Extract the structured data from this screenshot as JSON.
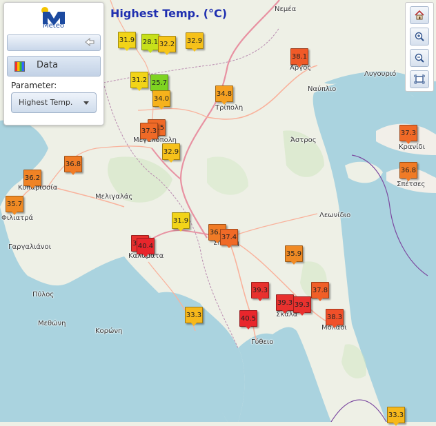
{
  "title": "Highest Temp. (°C)",
  "logo_text": "Meteo",
  "panel": {
    "data_tab_label": "Data",
    "parameter_label": "Parameter:",
    "parameter_value": "Highest Temp."
  },
  "toolbar": {
    "home_icon": "home-icon",
    "zoom_in_icon": "zoom-in-icon",
    "zoom_out_icon": "zoom-out-icon",
    "zoom_extent_icon": "zoom-extent-icon"
  },
  "colors": {
    "title": "#1f2fb0",
    "sea": "#aad3df",
    "land": "#eef0e6",
    "motorway": "#e892a2",
    "road": "#f9b29c"
  },
  "places": [
    "Νεμέα",
    "Άργος",
    "Ναύπλιο",
    "Λυγουριό",
    "Τρίπολη",
    "Μεγαλόπολη",
    "Άστρος",
    "Κρανίδι",
    "Σπέτσες",
    "Κυπαρισσία",
    "Μελιγαλάς",
    "Φιλιατρά",
    "Λεωνίδιο",
    "Σπάρτη",
    "Γαργαλιάνοι",
    "Καλαμάτα",
    "Πύλος",
    "Μεθώνη",
    "Κορώνη",
    "Σκάλα",
    "Γύθειο",
    "Μολάοι"
  ],
  "stations": [
    {
      "value": "31.9",
      "color": "#f2d418"
    },
    {
      "value": "28.1",
      "color": "#c7e01a"
    },
    {
      "value": "32.2",
      "color": "#f6c519"
    },
    {
      "value": "32.9",
      "color": "#f6c11a"
    },
    {
      "value": "38.1",
      "color": "#f05a28"
    },
    {
      "value": "31.2",
      "color": "#f2d418"
    },
    {
      "value": "25.7",
      "color": "#7ed321"
    },
    {
      "value": "34.0",
      "color": "#f6b21c"
    },
    {
      "value": "34.8",
      "color": "#f5a021"
    },
    {
      "value": "37.5",
      "color": "#f06a27"
    },
    {
      "value": "37.3",
      "color": "#f06a27"
    },
    {
      "value": "32.9",
      "color": "#f6c11a"
    },
    {
      "value": "37.3",
      "color": "#f06a27"
    },
    {
      "value": "36.8",
      "color": "#f07b26"
    },
    {
      "value": "36.8",
      "color": "#f07b26"
    },
    {
      "value": "36.2",
      "color": "#f08325"
    },
    {
      "value": "35.7",
      "color": "#f08a24"
    },
    {
      "value": "31.9",
      "color": "#f2d418"
    },
    {
      "value": "36.8",
      "color": "#f07b26"
    },
    {
      "value": "37.4",
      "color": "#f06a27"
    },
    {
      "value": "39.1",
      "color": "#e8312e"
    },
    {
      "value": "40.4",
      "color": "#e8262c"
    },
    {
      "value": "35.9",
      "color": "#f08a24"
    },
    {
      "value": "39.3",
      "color": "#e8312e"
    },
    {
      "value": "37.8",
      "color": "#f05f27"
    },
    {
      "value": "39.3",
      "color": "#e8312e"
    },
    {
      "value": "39.3",
      "color": "#e8312e"
    },
    {
      "value": "38.3",
      "color": "#f0502a"
    },
    {
      "value": "33.3",
      "color": "#f6b81b"
    },
    {
      "value": "40.5",
      "color": "#e8262c"
    },
    {
      "value": "33.3",
      "color": "#f6b81b"
    }
  ]
}
